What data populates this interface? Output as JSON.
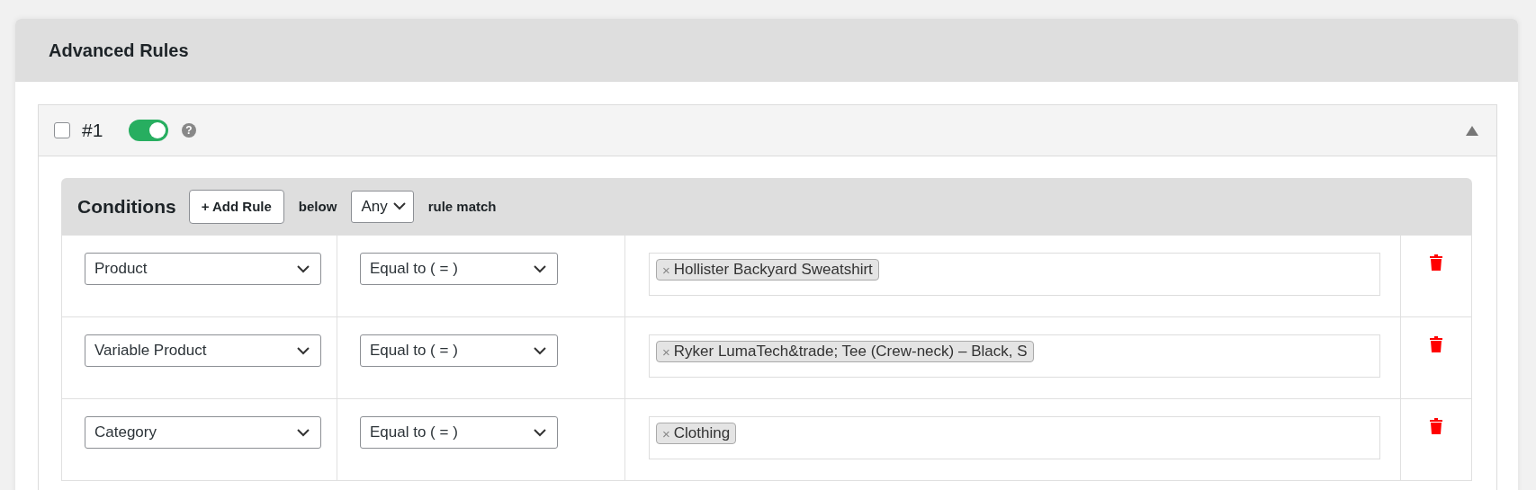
{
  "panel": {
    "title": "Advanced Rules"
  },
  "rule": {
    "checked": false,
    "number": "#1",
    "enabled": true,
    "help": "?",
    "expanded": true,
    "conditions": {
      "title": "Conditions",
      "add_button": "+ Add Rule",
      "below_label": "below",
      "match": "Any",
      "match_label": "rule match",
      "rows": [
        {
          "field": "Product",
          "operator": "Equal to ( = )",
          "tags": [
            {
              "remove": "×",
              "label": "Hollister Backyard Sweatshirt"
            }
          ]
        },
        {
          "field": "Variable Product",
          "operator": "Equal to ( = )",
          "tags": [
            {
              "remove": "×",
              "label": "Ryker LumaTech&trade; Tee (Crew-neck) – Black, S"
            }
          ]
        },
        {
          "field": "Category",
          "operator": "Equal to ( = )",
          "tags": [
            {
              "remove": "×",
              "label": "Clothing"
            }
          ]
        }
      ]
    }
  }
}
